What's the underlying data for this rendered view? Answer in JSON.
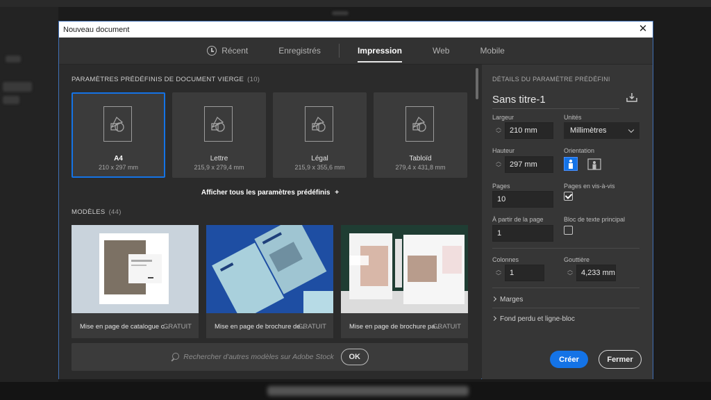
{
  "dialog": {
    "title": "Nouveau document",
    "close_symbol": "✕"
  },
  "tabs": [
    {
      "label": "Récent"
    },
    {
      "label": "Enregistrés"
    },
    {
      "label": "Impression",
      "active": true
    },
    {
      "label": "Web"
    },
    {
      "label": "Mobile"
    }
  ],
  "presets_section": {
    "title": "PARAMÈTRES PRÉDÉFINIS DE DOCUMENT VIERGE",
    "count": "(10)"
  },
  "presets": [
    {
      "name": "A4",
      "size": "210 x 297 mm",
      "selected": true
    },
    {
      "name": "Lettre",
      "size": "215,9 x 279,4 mm"
    },
    {
      "name": "Légal",
      "size": "215,9 x 355,6 mm"
    },
    {
      "name": "Tabloïd",
      "size": "279,4 x 431,8 mm"
    }
  ],
  "show_all": "Afficher tous les paramètres prédéfinis",
  "show_all_plus": "+",
  "templates_section": {
    "title": "MODÈLES",
    "count": "(44)"
  },
  "templates": [
    {
      "label": "Mise en page de catalogue c...",
      "price": "GRATUIT"
    },
    {
      "label": "Mise en page de brochure de...",
      "price": "GRATUIT"
    },
    {
      "label": "Mise en page de brochure pa...",
      "price": "GRATUIT"
    }
  ],
  "stock_search": {
    "placeholder": "Rechercher d'autres modèles sur Adobe Stock",
    "ok": "OK"
  },
  "details": {
    "heading": "DÉTAILS DU PARAMÈTRE PRÉDÉFINI",
    "doc_name": "Sans titre-1",
    "width_label": "Largeur",
    "width_value": "210 mm",
    "units_label": "Unités",
    "units_value": "Millimètres",
    "height_label": "Hauteur",
    "height_value": "297 mm",
    "orientation_label": "Orientation",
    "pages_label": "Pages",
    "pages_value": "10",
    "facing_label": "Pages en vis-à-vis",
    "start_label": "À partir de la page",
    "start_value": "1",
    "primary_text_label": "Bloc de texte principal",
    "columns_label": "Colonnes",
    "columns_value": "1",
    "gutter_label": "Gouttière",
    "gutter_value": "4,233 mm",
    "margins_label": "Marges",
    "bleed_label": "Fond perdu et ligne-bloc"
  },
  "buttons": {
    "create": "Créer",
    "close": "Fermer"
  },
  "colors": {
    "accent": "#1473e6"
  }
}
